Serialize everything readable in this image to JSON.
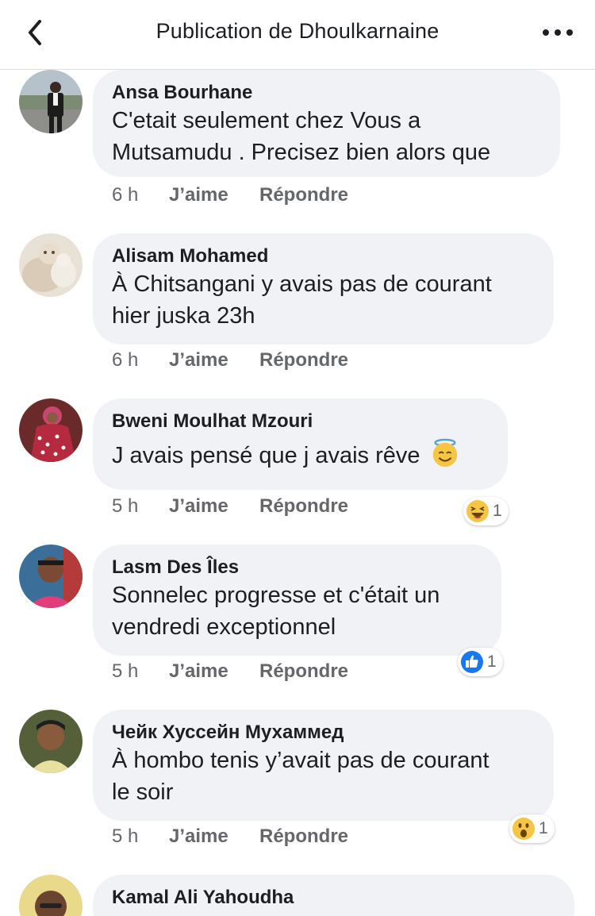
{
  "header": {
    "title": "Publication de Dhoulkarnaine",
    "back_icon": "chevron-left-icon",
    "more_icon": "more-horizontal-icon"
  },
  "comments": [
    {
      "author": "Ansa Bourhane",
      "lines": [
        "C'etait seulement chez Vous a",
        "Mutsamudu . Precisez  bien alors que"
      ],
      "time": "6 h",
      "like_label": "J’aime",
      "reply_label": "Répondre"
    },
    {
      "author": "Alisam Mohamed",
      "lines": [
        "À Chitsangani y avais pas de courant",
        "hier juska 23h"
      ],
      "time": "6 h",
      "like_label": "J’aime",
      "reply_label": "Répondre"
    },
    {
      "author": "Bweni Moulhat Mzouri",
      "lines": [
        "J avais pensé que j avais rêve"
      ],
      "inline_emoji": "smiling-face-with-halo-icon",
      "time": "5 h",
      "like_label": "J’aime",
      "reply_label": "Répondre",
      "reaction": {
        "icon": "laughing-reaction-icon",
        "count": "1"
      }
    },
    {
      "author": "Lasm Des Îles",
      "lines": [
        "Sonnelec progresse et c'était un",
        "vendredi exceptionnel"
      ],
      "time": "5 h",
      "like_label": "J’aime",
      "reply_label": "Répondre",
      "reaction": {
        "icon": "like-reaction-icon",
        "count": "1"
      }
    },
    {
      "author": "Чейк Хуссейн Мухаммед",
      "lines": [
        "À hombo tenis y’avait pas de courant",
        "le soir"
      ],
      "time": "5 h",
      "like_label": "J’aime",
      "reply_label": "Répondre",
      "reaction": {
        "icon": "wow-reaction-icon",
        "count": "1"
      }
    },
    {
      "author": "Kamal Ali Yahoudha"
    }
  ],
  "colors": {
    "bubble": "#f0f2f5",
    "meta_text": "#65676b",
    "like_blue": "#1877f2",
    "emoji_yellow": "#f7c544"
  }
}
